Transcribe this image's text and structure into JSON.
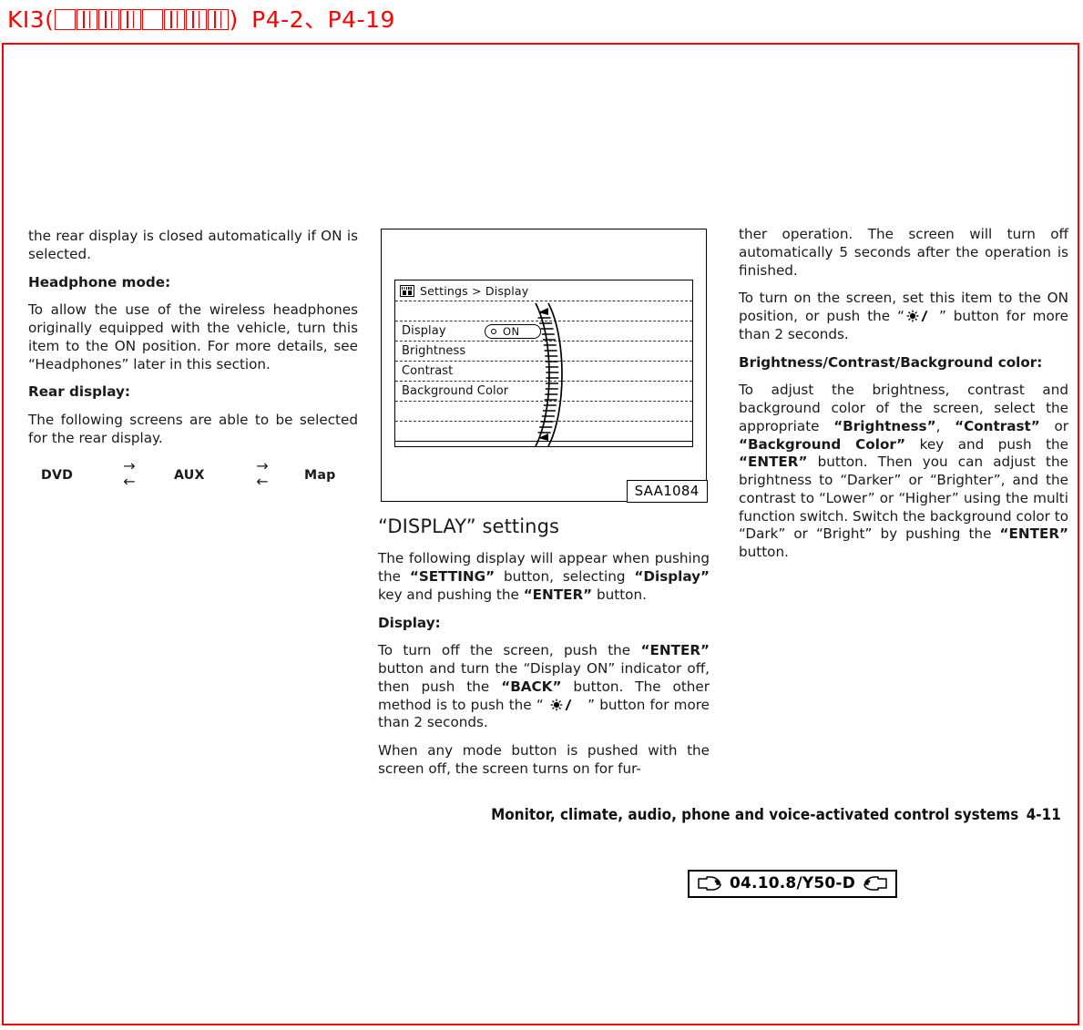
{
  "proof_header": {
    "prefix": "KI3(",
    "tofu_count": 8,
    "suffix": ")",
    "pages": "P4-2、P4-19",
    "color": "#ff0000"
  },
  "frame": {
    "border_color": "#ff0000"
  },
  "left_column": {
    "para_1": "the rear display is closed automatically if ON is selected.",
    "heading_1": "Headphone mode:",
    "para_2_a": "To allow the use of the wireless headphones originally equipped with the vehicle, turn this item to the ON position. For more details, see ",
    "para_2_quote": "“Headphones”",
    "para_2_b": " later in this section.",
    "heading_2": "Rear display:",
    "para_3": "The following screens are able to be selected for the rear display.",
    "flow": {
      "nodes": [
        "DVD",
        "AUX",
        "Map"
      ],
      "arrow_forward": "→",
      "arrow_reverse": "←"
    }
  },
  "illustration": {
    "nav_title": "Settings > Display",
    "title_icon": "panel-icon",
    "rows": [
      {
        "label": "",
        "blank": true
      },
      {
        "label": "Display",
        "toggle": {
          "state": "ON",
          "dot": "radio-dot"
        }
      },
      {
        "label": "Brightness"
      },
      {
        "label": "Contrast"
      },
      {
        "label": "Background Color"
      },
      {
        "label": "",
        "blank": true
      },
      {
        "label": "",
        "blank": true
      },
      {
        "label": "",
        "blank": true
      }
    ],
    "scroll_arc": {
      "up_arrow": "▲",
      "down_arrow": "▼"
    },
    "caption": "SAA1084"
  },
  "middle_column": {
    "section_title": "“DISPLAY” settings",
    "para_1_a": "The following display will appear when pushing the ",
    "para_1_setting": "“SETTING”",
    "para_1_b": " button, selecting ",
    "para_1_display": "“Display”",
    "para_1_c": " key and pushing the ",
    "para_1_enter": "“ENTER”",
    "para_1_d": " button.",
    "heading_display": "Display:",
    "para_2_a": "To turn off the screen, push the ",
    "para_2_enter": "“ENTER”",
    "para_2_b": " button and turn the “Display ON” indicator off, then push the ",
    "para_2_back": "“BACK”",
    "para_2_c": " button. The other method is to push the “ ",
    "para_2_d": " ” button for more than 2 seconds.",
    "para_3": "When any mode button is pushed with the screen off, the screen turns on for fur-"
  },
  "right_column": {
    "para_1": "ther operation. The screen will turn off automatically 5 seconds after the operation is finished.",
    "para_2_a": "To turn on the screen, set this item to the ON position, or push the “",
    "para_2_b": "” button for more than 2 seconds.",
    "heading": "Brightness/Contrast/Background color:",
    "para_3_a": "To adjust the brightness, contrast and background color of the screen, select the appropriate ",
    "para_3_brightness": "“Brightness”",
    "para_3_comma": ", ",
    "para_3_contrast": "“Contrast”",
    "para_3_or": " or ",
    "para_3_bgcolor": "“Background Color”",
    "para_3_b": " key and push the ",
    "para_3_enter1": "“ENTER”",
    "para_3_c": " button. Then you can adjust the brightness to “Darker” or “Brighter”, and the contrast to “Lower” or “Higher” using the multi function switch. Switch the background color to “Dark” or “Bright” by pushing the ",
    "para_3_enter2": "“ENTER”",
    "para_3_d": " button."
  },
  "footer": {
    "title": "Monitor, climate, audio, phone and voice-activated control systems",
    "page_number": "4-11"
  },
  "datestamp": {
    "left_icon": "hand-pointing-right-icon",
    "text": "04.10.8/Y50-D",
    "right_icon": "hand-pointing-left-icon"
  }
}
